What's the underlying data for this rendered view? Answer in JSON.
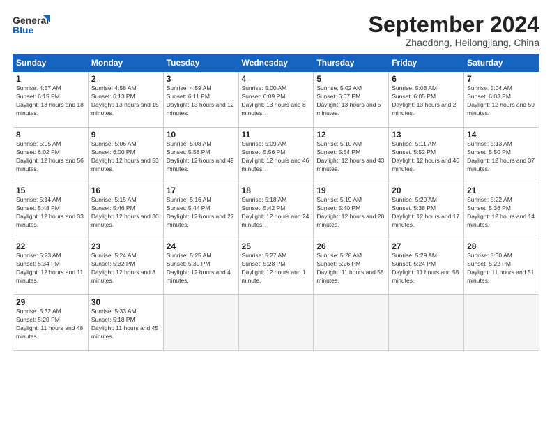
{
  "header": {
    "logo_general": "General",
    "logo_blue": "Blue",
    "month_title": "September 2024",
    "subtitle": "Zhaodong, Heilongjiang, China"
  },
  "weekdays": [
    "Sunday",
    "Monday",
    "Tuesday",
    "Wednesday",
    "Thursday",
    "Friday",
    "Saturday"
  ],
  "weeks": [
    [
      {
        "day": "1",
        "sunrise": "Sunrise: 4:57 AM",
        "sunset": "Sunset: 6:15 PM",
        "daylight": "Daylight: 13 hours and 18 minutes."
      },
      {
        "day": "2",
        "sunrise": "Sunrise: 4:58 AM",
        "sunset": "Sunset: 6:13 PM",
        "daylight": "Daylight: 13 hours and 15 minutes."
      },
      {
        "day": "3",
        "sunrise": "Sunrise: 4:59 AM",
        "sunset": "Sunset: 6:11 PM",
        "daylight": "Daylight: 13 hours and 12 minutes."
      },
      {
        "day": "4",
        "sunrise": "Sunrise: 5:00 AM",
        "sunset": "Sunset: 6:09 PM",
        "daylight": "Daylight: 13 hours and 8 minutes."
      },
      {
        "day": "5",
        "sunrise": "Sunrise: 5:02 AM",
        "sunset": "Sunset: 6:07 PM",
        "daylight": "Daylight: 13 hours and 5 minutes."
      },
      {
        "day": "6",
        "sunrise": "Sunrise: 5:03 AM",
        "sunset": "Sunset: 6:05 PM",
        "daylight": "Daylight: 13 hours and 2 minutes."
      },
      {
        "day": "7",
        "sunrise": "Sunrise: 5:04 AM",
        "sunset": "Sunset: 6:03 PM",
        "daylight": "Daylight: 12 hours and 59 minutes."
      }
    ],
    [
      {
        "day": "8",
        "sunrise": "Sunrise: 5:05 AM",
        "sunset": "Sunset: 6:02 PM",
        "daylight": "Daylight: 12 hours and 56 minutes."
      },
      {
        "day": "9",
        "sunrise": "Sunrise: 5:06 AM",
        "sunset": "Sunset: 6:00 PM",
        "daylight": "Daylight: 12 hours and 53 minutes."
      },
      {
        "day": "10",
        "sunrise": "Sunrise: 5:08 AM",
        "sunset": "Sunset: 5:58 PM",
        "daylight": "Daylight: 12 hours and 49 minutes."
      },
      {
        "day": "11",
        "sunrise": "Sunrise: 5:09 AM",
        "sunset": "Sunset: 5:56 PM",
        "daylight": "Daylight: 12 hours and 46 minutes."
      },
      {
        "day": "12",
        "sunrise": "Sunrise: 5:10 AM",
        "sunset": "Sunset: 5:54 PM",
        "daylight": "Daylight: 12 hours and 43 minutes."
      },
      {
        "day": "13",
        "sunrise": "Sunrise: 5:11 AM",
        "sunset": "Sunset: 5:52 PM",
        "daylight": "Daylight: 12 hours and 40 minutes."
      },
      {
        "day": "14",
        "sunrise": "Sunrise: 5:13 AM",
        "sunset": "Sunset: 5:50 PM",
        "daylight": "Daylight: 12 hours and 37 minutes."
      }
    ],
    [
      {
        "day": "15",
        "sunrise": "Sunrise: 5:14 AM",
        "sunset": "Sunset: 5:48 PM",
        "daylight": "Daylight: 12 hours and 33 minutes."
      },
      {
        "day": "16",
        "sunrise": "Sunrise: 5:15 AM",
        "sunset": "Sunset: 5:46 PM",
        "daylight": "Daylight: 12 hours and 30 minutes."
      },
      {
        "day": "17",
        "sunrise": "Sunrise: 5:16 AM",
        "sunset": "Sunset: 5:44 PM",
        "daylight": "Daylight: 12 hours and 27 minutes."
      },
      {
        "day": "18",
        "sunrise": "Sunrise: 5:18 AM",
        "sunset": "Sunset: 5:42 PM",
        "daylight": "Daylight: 12 hours and 24 minutes."
      },
      {
        "day": "19",
        "sunrise": "Sunrise: 5:19 AM",
        "sunset": "Sunset: 5:40 PM",
        "daylight": "Daylight: 12 hours and 20 minutes."
      },
      {
        "day": "20",
        "sunrise": "Sunrise: 5:20 AM",
        "sunset": "Sunset: 5:38 PM",
        "daylight": "Daylight: 12 hours and 17 minutes."
      },
      {
        "day": "21",
        "sunrise": "Sunrise: 5:22 AM",
        "sunset": "Sunset: 5:36 PM",
        "daylight": "Daylight: 12 hours and 14 minutes."
      }
    ],
    [
      {
        "day": "22",
        "sunrise": "Sunrise: 5:23 AM",
        "sunset": "Sunset: 5:34 PM",
        "daylight": "Daylight: 12 hours and 11 minutes."
      },
      {
        "day": "23",
        "sunrise": "Sunrise: 5:24 AM",
        "sunset": "Sunset: 5:32 PM",
        "daylight": "Daylight: 12 hours and 8 minutes."
      },
      {
        "day": "24",
        "sunrise": "Sunrise: 5:25 AM",
        "sunset": "Sunset: 5:30 PM",
        "daylight": "Daylight: 12 hours and 4 minutes."
      },
      {
        "day": "25",
        "sunrise": "Sunrise: 5:27 AM",
        "sunset": "Sunset: 5:28 PM",
        "daylight": "Daylight: 12 hours and 1 minute."
      },
      {
        "day": "26",
        "sunrise": "Sunrise: 5:28 AM",
        "sunset": "Sunset: 5:26 PM",
        "daylight": "Daylight: 11 hours and 58 minutes."
      },
      {
        "day": "27",
        "sunrise": "Sunrise: 5:29 AM",
        "sunset": "Sunset: 5:24 PM",
        "daylight": "Daylight: 11 hours and 55 minutes."
      },
      {
        "day": "28",
        "sunrise": "Sunrise: 5:30 AM",
        "sunset": "Sunset: 5:22 PM",
        "daylight": "Daylight: 11 hours and 51 minutes."
      }
    ],
    [
      {
        "day": "29",
        "sunrise": "Sunrise: 5:32 AM",
        "sunset": "Sunset: 5:20 PM",
        "daylight": "Daylight: 11 hours and 48 minutes."
      },
      {
        "day": "30",
        "sunrise": "Sunrise: 5:33 AM",
        "sunset": "Sunset: 5:18 PM",
        "daylight": "Daylight: 11 hours and 45 minutes."
      },
      {
        "day": "",
        "sunrise": "",
        "sunset": "",
        "daylight": ""
      },
      {
        "day": "",
        "sunrise": "",
        "sunset": "",
        "daylight": ""
      },
      {
        "day": "",
        "sunrise": "",
        "sunset": "",
        "daylight": ""
      },
      {
        "day": "",
        "sunrise": "",
        "sunset": "",
        "daylight": ""
      },
      {
        "day": "",
        "sunrise": "",
        "sunset": "",
        "daylight": ""
      }
    ]
  ]
}
